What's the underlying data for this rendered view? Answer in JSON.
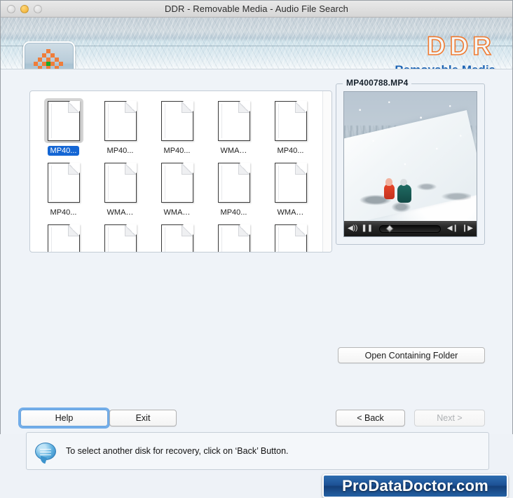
{
  "window": {
    "title": "DDR - Removable Media - Audio File Search",
    "traffic_lights": [
      "close-button",
      "minimize-button",
      "zoom-button"
    ]
  },
  "header": {
    "logo_word": "DDR",
    "logo_sub": "Removable Media",
    "app_icon": "ddr-flower-icon",
    "colors": {
      "logo_orange": "#f07a30",
      "logo_blue": "#1b63b4"
    }
  },
  "files": {
    "rows": [
      [
        {
          "label": "MP40...",
          "selected": true
        },
        {
          "label": "MP40...",
          "selected": false
        },
        {
          "label": "MP40...",
          "selected": false
        },
        {
          "label": "WMA…",
          "selected": false
        },
        {
          "label": "MP40...",
          "selected": false
        }
      ],
      [
        {
          "label": "MP40...",
          "selected": false
        },
        {
          "label": "WMA…",
          "selected": false
        },
        {
          "label": "WMA…",
          "selected": false
        },
        {
          "label": "MP40...",
          "selected": false
        },
        {
          "label": "WMA…",
          "selected": false
        }
      ],
      [
        {
          "label": "",
          "selected": false
        },
        {
          "label": "",
          "selected": false
        },
        {
          "label": "",
          "selected": false
        },
        {
          "label": "",
          "selected": false
        },
        {
          "label": "",
          "selected": false
        }
      ]
    ]
  },
  "preview": {
    "filename": "MP400788.MP4",
    "player": {
      "volume_icon": "speaker-icon",
      "pause_icon": "pause-icon",
      "prev_icon": "step-back-icon",
      "next_icon": "step-forward-icon"
    }
  },
  "buttons": {
    "open_containing_folder": "Open Containing Folder",
    "help": "Help",
    "exit": "Exit",
    "back": "< Back",
    "next": "Next >"
  },
  "status": {
    "icon": "speech-bubble-icon",
    "message": "To select another disk for recovery, click on ‘Back’ Button."
  },
  "brand": {
    "text": "ProDataDoctor.com"
  }
}
